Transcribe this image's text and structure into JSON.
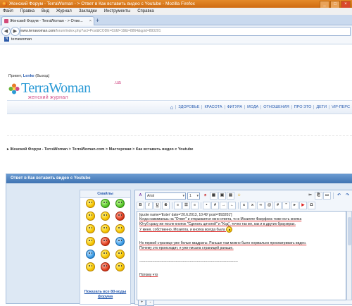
{
  "browser": {
    "title": "Женский Форум - TerraWoman - > Ответ в Как вставить видео с Youtube - Mozilla Firefox",
    "menu": [
      "Файл",
      "Правка",
      "Вид",
      "Журнал",
      "Закладки",
      "Инструменты",
      "Справка"
    ],
    "tab_label": "Женский Форум - TerraWoman - > Отве...",
    "url_domain": "www.terrawoman.com",
    "url_rest": "/forum/index.php?act=Post&CODE=02&f=18&t=8864&qpid=893201",
    "bookmark": "terrawoman"
  },
  "site": {
    "greeting_prefix": "Привет,",
    "username": "Lenke",
    "logout": "(Выход)",
    "logo_main": "TerraWoman",
    "logo_tld": ".ua",
    "logo_tagline": "женский журнал",
    "nav": [
      "ЗДОРОВЬЕ",
      "КРАСОТА",
      "ФИГУРА",
      "МОДА",
      "ОТНОШЕНИЯ",
      "ПРО ЭТО",
      "ДЕТИ",
      "VIP-ПЕРС"
    ]
  },
  "breadcrumbs": [
    "Женский Форум - TerraWoman",
    "TerraWoman.com",
    "Мастерская",
    "Как вставить видео с Youtube"
  ],
  "panel": {
    "title": "Ответ в Как вставить видео с Youtube"
  },
  "smileys": {
    "title": "Смайлы",
    "show_all": "Показать все 80-коды форума",
    "count": 18
  },
  "editor": {
    "font_select": "Arial",
    "size_select": "1",
    "format_buttons": [
      "B",
      "I",
      "U",
      "S"
    ],
    "lines": [
      "[quote name='Ester' date='20.6.2013, 10:49' post='893201']",
      "Когда нажимаешь на \"Ответ\" и открывается окно ответа, то в Мозилле Фаерфокс тоже есть кнопка",
      "Ютуб сразу же после кнопок \"Сделать цитатой\" и \"Код\", точно так же, как и в других браузерах.",
      "У меня, собственно, Мозилла, и кнопка всегда была",
      "",
      "",
      "Но первой странице уже белые квадраты. Раньше там можно было нормально просматривать видео.",
      "Почему это происходит, я уже писала страницей раньше.",
      "",
      "",
      "------------------------------------------------------------------------------------",
      "",
      "",
      "Потому что"
    ],
    "resize_plus": "+",
    "resize_minus": "-"
  }
}
